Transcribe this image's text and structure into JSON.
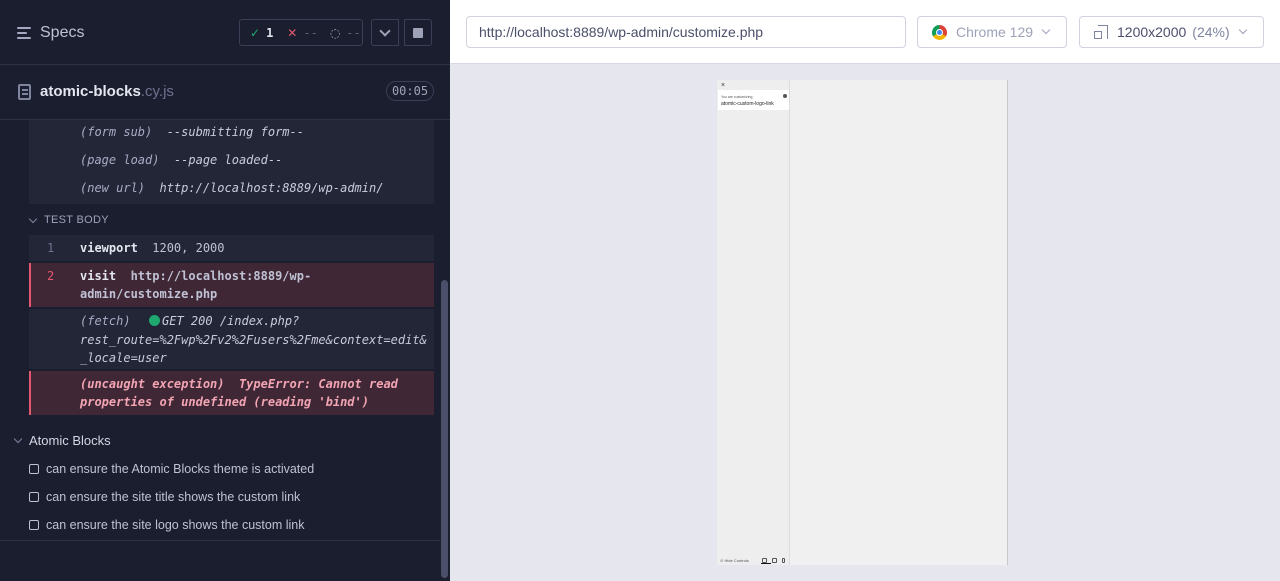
{
  "reporter": {
    "specs_label": "Specs",
    "stats": {
      "passed": "1",
      "failed": "--",
      "pending": "--"
    },
    "file": {
      "name": "atomic-blocks",
      "ext": ".cy.js",
      "duration": "00:05"
    },
    "before_commands": [
      {
        "name": "(form sub)",
        "message": "--submitting form--"
      },
      {
        "name": "(page load)",
        "message": "--page loaded--"
      },
      {
        "name": "(new url)",
        "message": "http://localhost:8889/wp-admin/"
      }
    ],
    "test_body_label": "TEST BODY",
    "commands": [
      {
        "num": "1",
        "name": "viewport",
        "message": "1200, 2000"
      },
      {
        "num": "2",
        "name": "visit",
        "message_line1": "http://localhost:8889/wp-",
        "message_line2": "admin/customize.php"
      }
    ],
    "fetch": {
      "name": "(fetch)",
      "line1": "GET 200 /index.php?",
      "line2": "rest_route=%2Fwp%2Fv2%2Fusers%2Fme&context=edit&",
      "line3": "_locale=user"
    },
    "exception": {
      "name": "(uncaught exception)",
      "line1": "TypeError: Cannot read",
      "line2": "properties of undefined (reading 'bind')"
    },
    "suite_title": "Atomic Blocks",
    "tests": [
      "can ensure the Atomic Blocks theme is activated",
      "can ensure the site title shows the custom link",
      "can ensure the site logo shows the custom link"
    ]
  },
  "browser_bar": {
    "url": "http://localhost:8889/wp-admin/customize.php",
    "browser": "Chrome 129",
    "viewport": "1200x2000",
    "scale": "(24%)"
  },
  "aut": {
    "close": "×",
    "customizing": "You are customizing",
    "site_title": "atomic-custom-logo-link",
    "hide_controls": "Hide Controls"
  },
  "colors": {
    "pass": "#1fa971",
    "fail": "#e45770",
    "panel_bg": "#1b1e2e"
  }
}
